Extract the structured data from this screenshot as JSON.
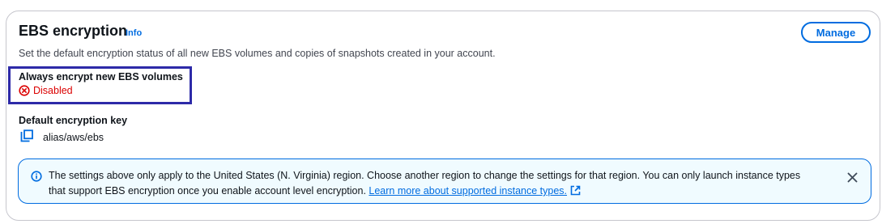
{
  "panel": {
    "title": "EBS encryption",
    "info_label": "Info",
    "description": "Set the default encryption status of all new EBS volumes and copies of snapshots created in your account.",
    "manage_label": "Manage"
  },
  "always_encrypt": {
    "label": "Always encrypt new EBS volumes",
    "status": "Disabled",
    "status_icon": "x-circle-icon",
    "status_color": "#db0000"
  },
  "default_key": {
    "label": "Default encryption key",
    "value": "alias/aws/ebs",
    "copy_icon": "copy-icon"
  },
  "alert": {
    "type": "info",
    "icon": "info-icon",
    "text": "The settings above only apply to the United States (N. Virginia) region. Choose another region to change the settings for that region. You can only launch instance types that support EBS encryption once you enable account level encryption.",
    "link_text": "Learn more about supported instance types.",
    "link_icon": "external-link-icon",
    "dismiss_icon": "close-icon"
  },
  "colors": {
    "accent": "#006ce0",
    "error": "#db0000",
    "highlight": "#2d2aa8",
    "alert_background": "#f0fbff",
    "border": "#c6c6cd"
  }
}
